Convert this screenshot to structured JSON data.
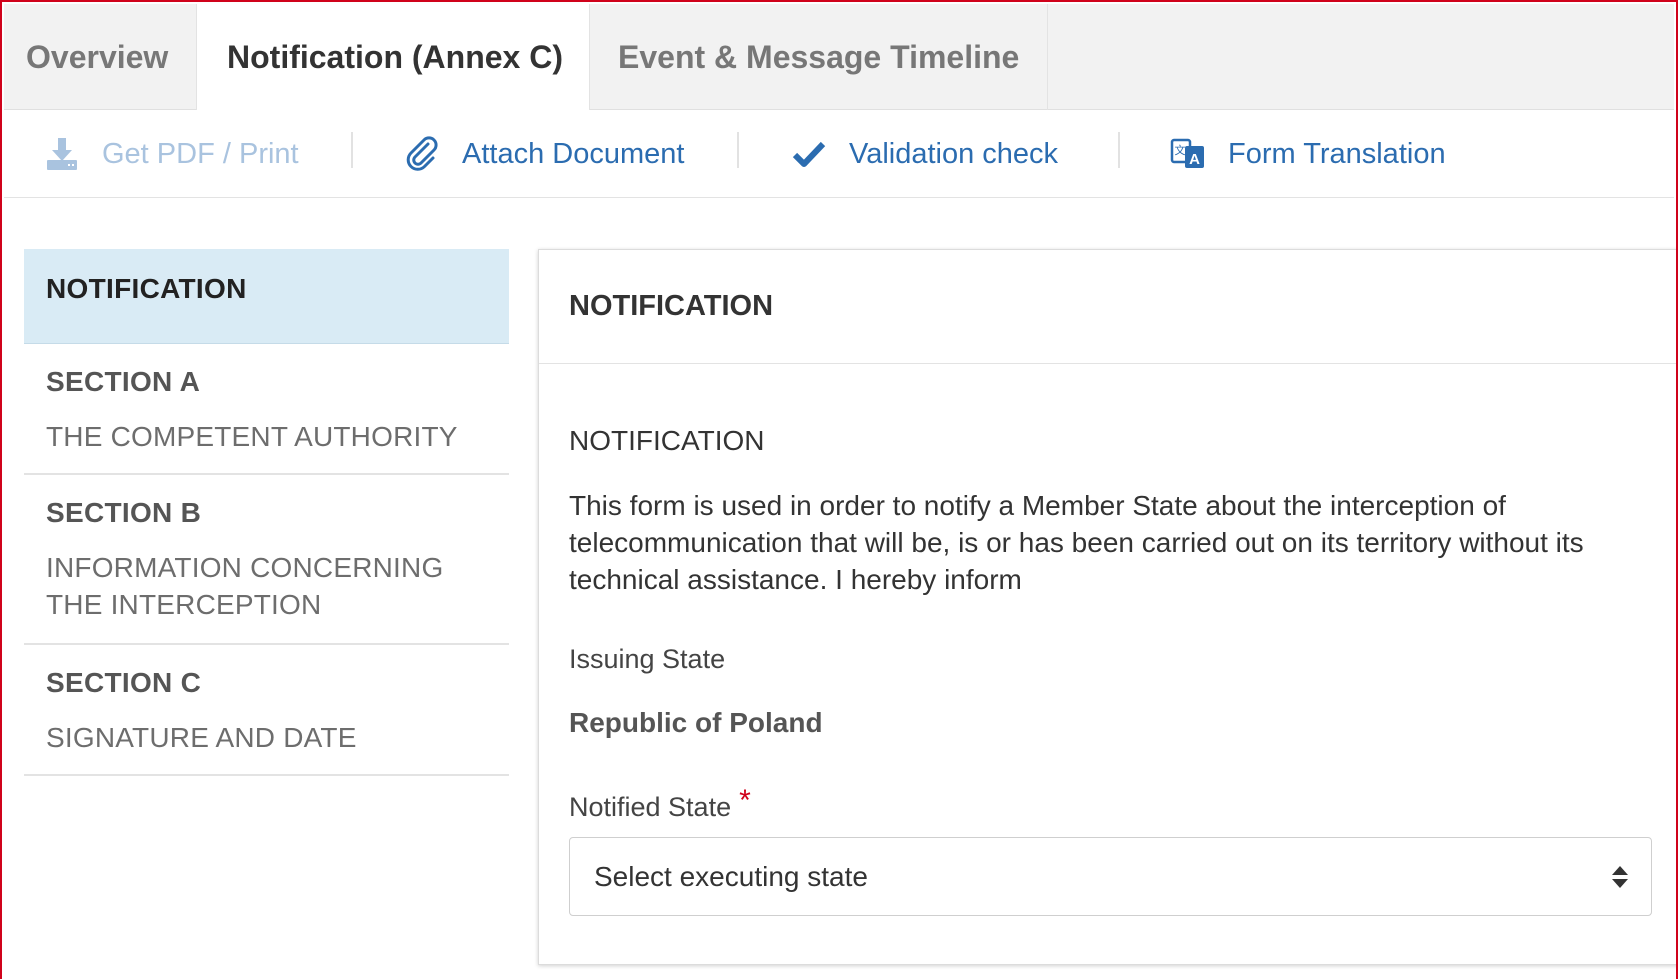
{
  "tabs": [
    {
      "label": "Overview"
    },
    {
      "label": "Notification (Annex C)"
    },
    {
      "label": "Event & Message Timeline"
    }
  ],
  "toolbar": {
    "get_pdf": "Get PDF / Print",
    "attach": "Attach Document",
    "validate": "Validation check",
    "translate": "Form Translation"
  },
  "nav": [
    {
      "title": "NOTIFICATION",
      "subtitle": ""
    },
    {
      "title": "SECTION A",
      "subtitle": "THE COMPETENT AUTHORITY"
    },
    {
      "title": "SECTION B",
      "subtitle": "INFORMATION CONCERNING THE INTERCEPTION"
    },
    {
      "title": "SECTION C",
      "subtitle": "SIGNATURE AND DATE"
    }
  ],
  "panel": {
    "header": "NOTIFICATION",
    "sub_heading": "NOTIFICATION",
    "description": "This form is used in order to notify a Member State about the interception of telecommunication that will be, is or has been carried out on its territory without its technical assistance. I hereby inform",
    "issuing_label": "Issuing State",
    "issuing_value": "Republic of Poland",
    "notified_label": "Notified State",
    "required_mark": "*",
    "notified_placeholder": "Select executing state"
  },
  "colors": {
    "accent": "#2b6cb0",
    "active_nav_bg": "#d9ebf5",
    "required": "#d0021b"
  },
  "icons": {
    "download": "download-icon",
    "attach": "paperclip-icon",
    "check": "checkmark-icon",
    "translate": "translate-icon",
    "select_caret": "sort-caret-icon"
  }
}
